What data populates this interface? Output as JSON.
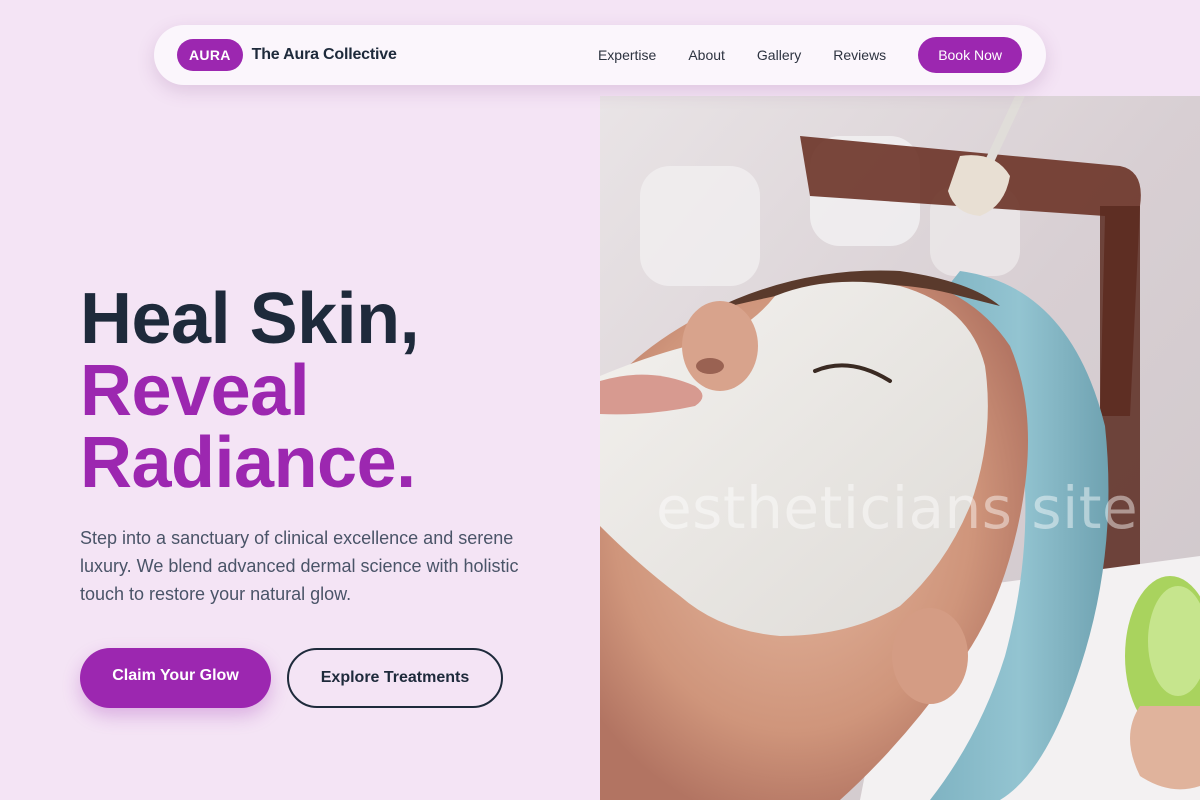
{
  "nav": {
    "badge": "AURA",
    "brand_name": "The Aura Collective",
    "links": [
      "Expertise",
      "About",
      "Gallery",
      "Reviews"
    ],
    "cta": "Book Now"
  },
  "hero": {
    "title_line1": "Heal Skin,",
    "title_line2": "Reveal",
    "title_line3": "Radiance.",
    "description": "Step into a sanctuary of clinical excellence and serene luxury. We blend advanced dermal science with holistic touch to restore your natural glow.",
    "primary_cta": "Claim Your Glow",
    "secondary_cta": "Explore Treatments"
  },
  "image": {
    "watermark": "estheticians site"
  },
  "colors": {
    "background": "#f4e4f5",
    "accent": "#9c27b0",
    "text_dark": "#1e2a3b",
    "text_muted": "#4a5468"
  }
}
